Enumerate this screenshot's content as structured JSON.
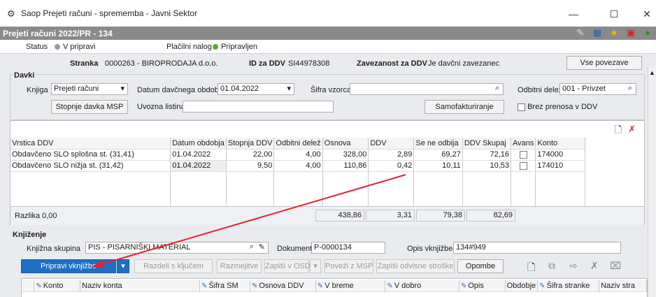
{
  "window": {
    "title": "Saop Prejeti računi - sprememba - Javni Sektor",
    "minimize": "—",
    "maximize": "☐",
    "close": "✕"
  },
  "header": {
    "title": "Prejeti računi 2022/PR - 134"
  },
  "status": {
    "status_label": "Status",
    "status_value": "V pripravi",
    "status_color": "#9a9a9a",
    "nalog_label": "Plačilni nalog",
    "nalog_value": "Pripravljen",
    "nalog_color": "#5aab2c"
  },
  "party": {
    "stranka_label": "Stranka",
    "stranka_value": "0000263 - BIROPRODAJA d.o.o.",
    "ddv_label": "ID za DDV",
    "ddv_value": "SI44978308",
    "zavez_label": "Zavezanost za DDV",
    "zavez_value": "Je davčni zavezanec",
    "vse_btn": "Vse povezave"
  },
  "davki": {
    "title": "Davki",
    "knjiga_label": "Knjiga",
    "knjiga_value": "Prejeti računi",
    "datum_label": "Datum davčnega obdobja",
    "datum_value": "01.04.2022",
    "sifra_label": "Šifra vzorca",
    "sifra_value": "",
    "odbitni_label": "Odbitni delež",
    "odbitni_value": "001 - Privzet",
    "stopnje_btn": "Stopnje davka MSP",
    "uvozna_label": "Uvozna listina",
    "uvozna_value": "",
    "samo_btn": "Samofakturiranje",
    "brez_label": "Brez prenosa v DDV"
  },
  "taxgrid": {
    "headers": [
      "Vrstica DDV",
      "Datum obdobja",
      "Stopnja DDV",
      "Odbitni delež",
      "Osnova",
      "DDV",
      "Se ne odbija",
      "DDV Skupaj",
      "Avans",
      "Konto"
    ],
    "rows": [
      [
        "Obdavčeno SLO splošna st. (31,41)",
        "01.04.2022",
        "22,00",
        "4,00",
        "328,00",
        "2,89",
        "69,27",
        "72,16",
        "",
        "174000"
      ],
      [
        "Obdavčeno SLO nižja st. (31,42)",
        "01.04.2022",
        "9,50",
        "4,00",
        "110,86",
        "0,42",
        "10,11",
        "10,53",
        "",
        "174010"
      ]
    ],
    "razlika": "Razlika 0,00",
    "sum_osnova": "438,86",
    "sum_ddv": "3,31",
    "sum_seneodbija": "79,38",
    "sum_skupaj": "82,69"
  },
  "knjizenje": {
    "title": "Knjiženje",
    "skupina_label": "Knjižna skupina",
    "skupina_value": "PIS - PISARNIŠKI MATERIAL",
    "dokument_label": "Dokument",
    "dokument_value": "P-0000134",
    "opis_label": "Opis vknjižbe",
    "opis_value": "134#949",
    "buttons": {
      "pripravi": "Pripravi vknjižbe",
      "razdeli": "Razdeli s ključem",
      "razmejitve": "Razmejitve",
      "zapisi_osd": "Zapiši v OSD",
      "povezi": "Poveži z MSP",
      "zapisi_odv": "Zapiši odvisne stroške",
      "opombe": "Opombe"
    },
    "grid_headers": [
      "Konto",
      "Naziv konta",
      "Šifra SM",
      "Osnova DDV",
      "V breme",
      "V dobro",
      "Opis",
      "Obdobje",
      "Šifra stranke",
      "Naziv stra"
    ]
  },
  "colors": {
    "accent": "#1e6fc1",
    "header_bar": "#8a8a8a",
    "arrow": "#e8202a"
  }
}
